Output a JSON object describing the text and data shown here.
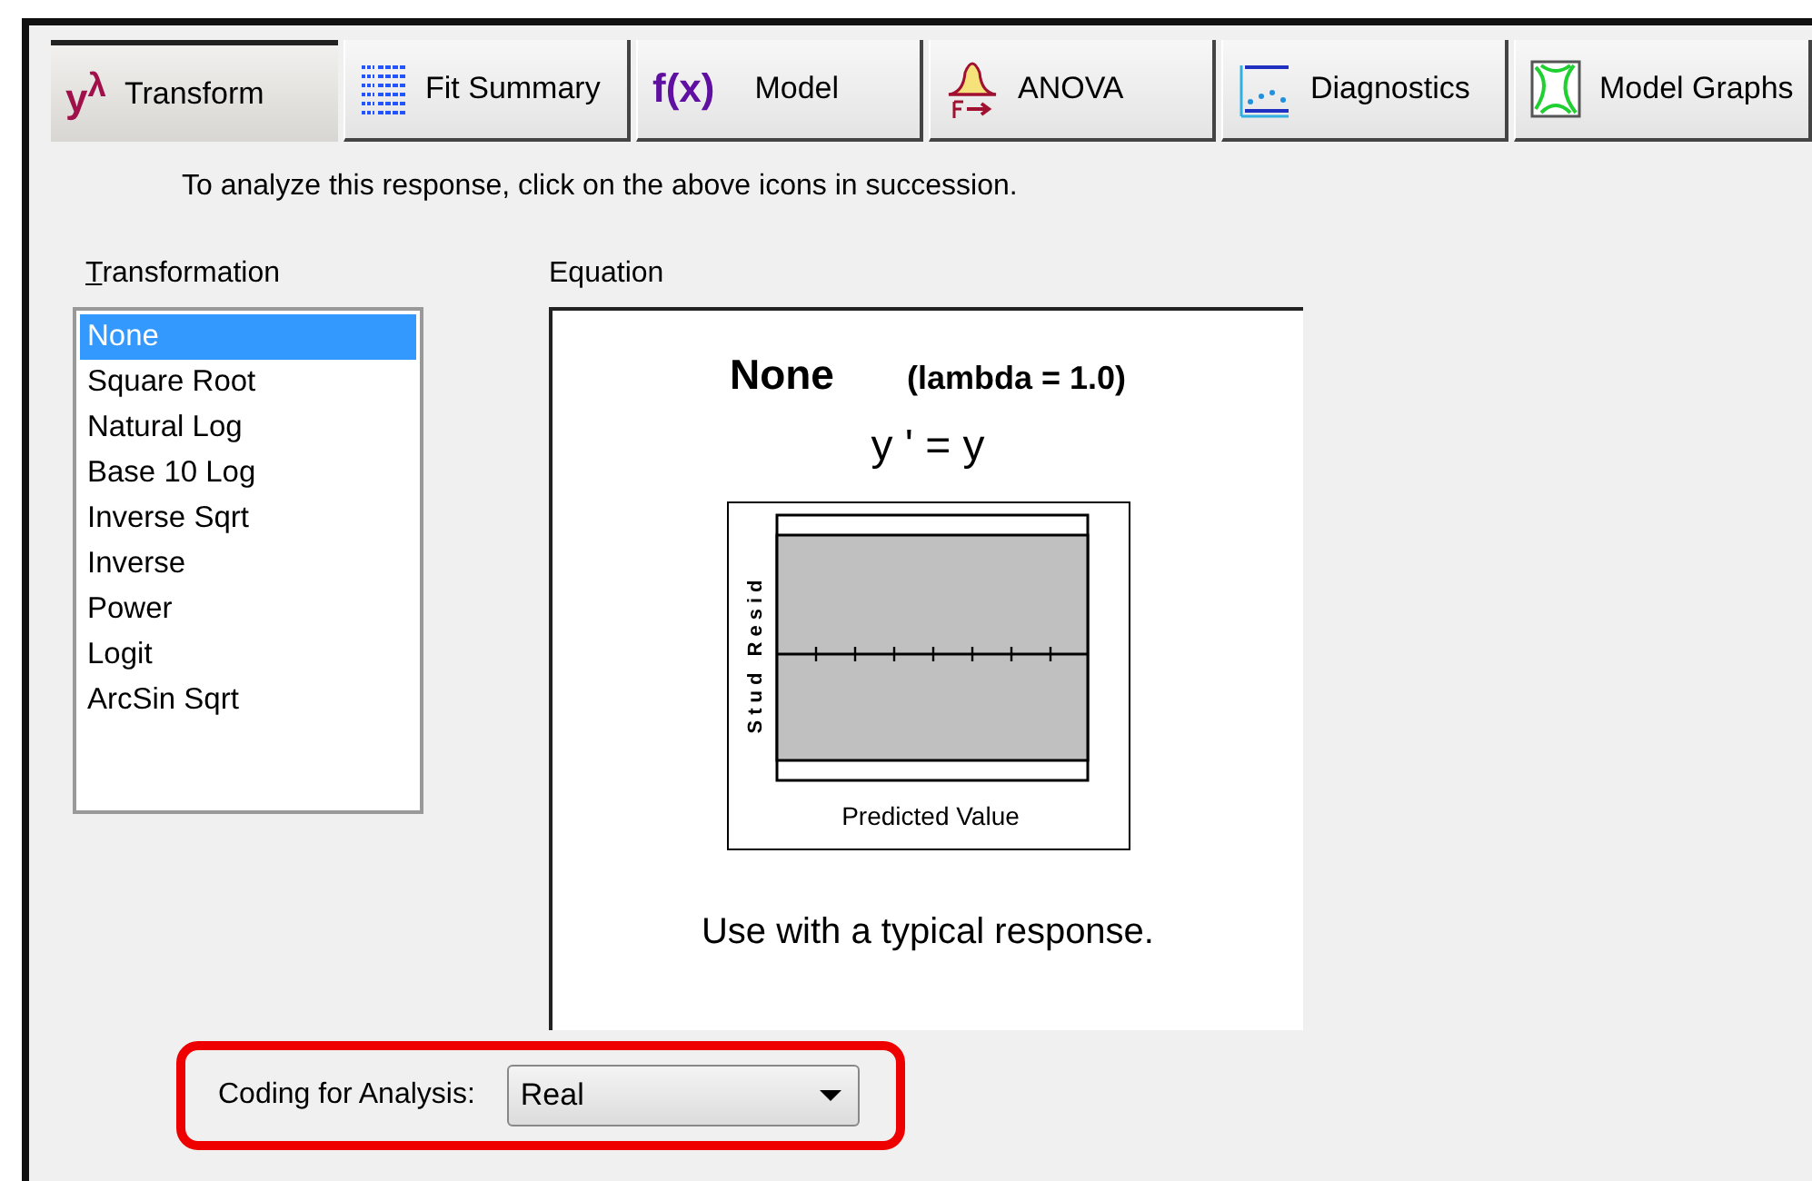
{
  "tabs": [
    {
      "label": "Transform",
      "kind": "power",
      "glyph": "y$^{λ}$",
      "selected": true
    },
    {
      "label": "Fit Summary",
      "kind": "table",
      "selected": false
    },
    {
      "label": "Model",
      "kind": "function",
      "glyph": "f(x)",
      "selected": false
    },
    {
      "label": "ANOVA",
      "kind": "distribution",
      "selected": false
    },
    {
      "label": "Diagnostics",
      "kind": "scatter",
      "selected": false
    },
    {
      "label": "Model Graphs",
      "kind": "contour",
      "selected": false
    }
  ],
  "instruction": "To analyze this response, click on the above icons in succession.",
  "transformation": {
    "label": "Transformation",
    "items": [
      {
        "label": "None",
        "selected": true
      },
      {
        "label": "Square Root",
        "selected": false
      },
      {
        "label": "Natural Log",
        "selected": false
      },
      {
        "label": "Base 10 Log",
        "selected": false
      },
      {
        "label": "Inverse Sqrt",
        "selected": false
      },
      {
        "label": "Inverse",
        "selected": false
      },
      {
        "label": "Power",
        "selected": false
      },
      {
        "label": "Logit",
        "selected": false
      },
      {
        "label": "ArcSin Sqrt",
        "selected": false
      }
    ]
  },
  "equation": {
    "label": "Equation",
    "name": "None",
    "lambda": "(lambda = 1.0)",
    "formula": "y ' = y",
    "plot": {
      "ylabel": "Stud Resid",
      "xlabel": "Predicted Value"
    },
    "note": "Use with a typical response."
  },
  "coding": {
    "label": "Coding for Analysis:",
    "value": "Real",
    "highlighted": true
  }
}
